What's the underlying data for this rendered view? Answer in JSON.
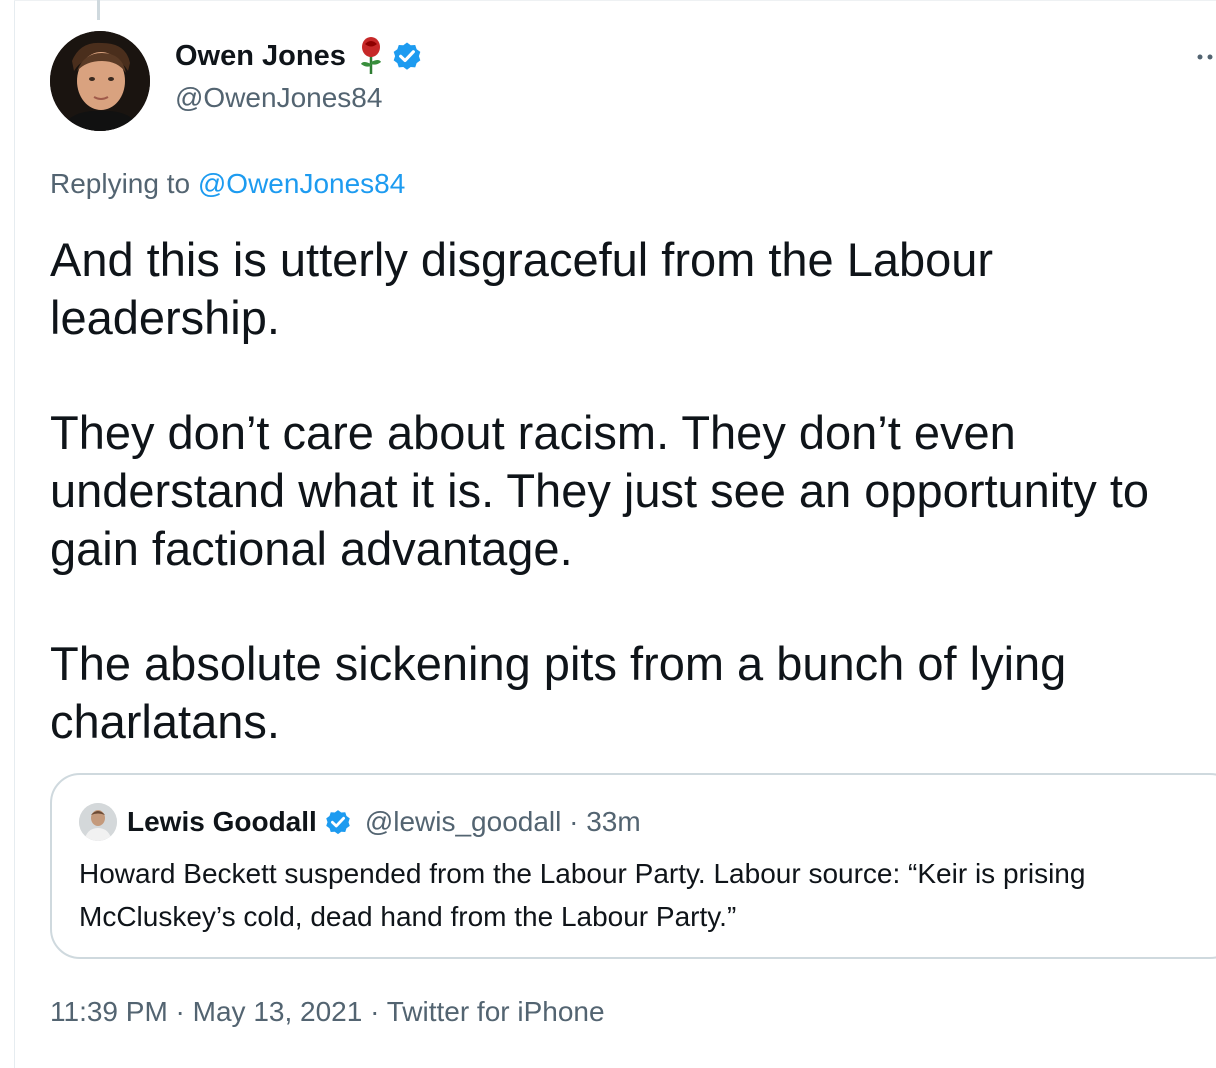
{
  "tweet": {
    "author": {
      "display_name": "Owen Jones",
      "handle": "@OwenJones84",
      "badges": [
        "rose-icon",
        "verified-badge-icon"
      ]
    },
    "reply": {
      "prefix": "Replying to",
      "handle": "@OwenJones84"
    },
    "paragraphs": [
      "And this is utterly disgraceful from the Labour leadership.",
      "They don’t care about racism. They don’t even understand what it is. They just see an opportunity to gain factional advantage.",
      "The absolute sickening pits from a bunch of lying charlatans."
    ],
    "quote": {
      "display_name": "Lewis Goodall",
      "handle_time": "@lewis_goodall · 33m",
      "text": "Howard Beckett suspended from the Labour Party. Labour source: “Keir is prising McCluskey’s cold, dead hand from the Labour Party.”"
    },
    "meta": "11:39 PM · May 13, 2021 · Twitter for iPhone"
  },
  "colors": {
    "text_primary": "#0f1419",
    "text_secondary": "#536471",
    "link": "#1d9bf0",
    "verified": "#1d9bf0",
    "border": "#cfd9de"
  }
}
